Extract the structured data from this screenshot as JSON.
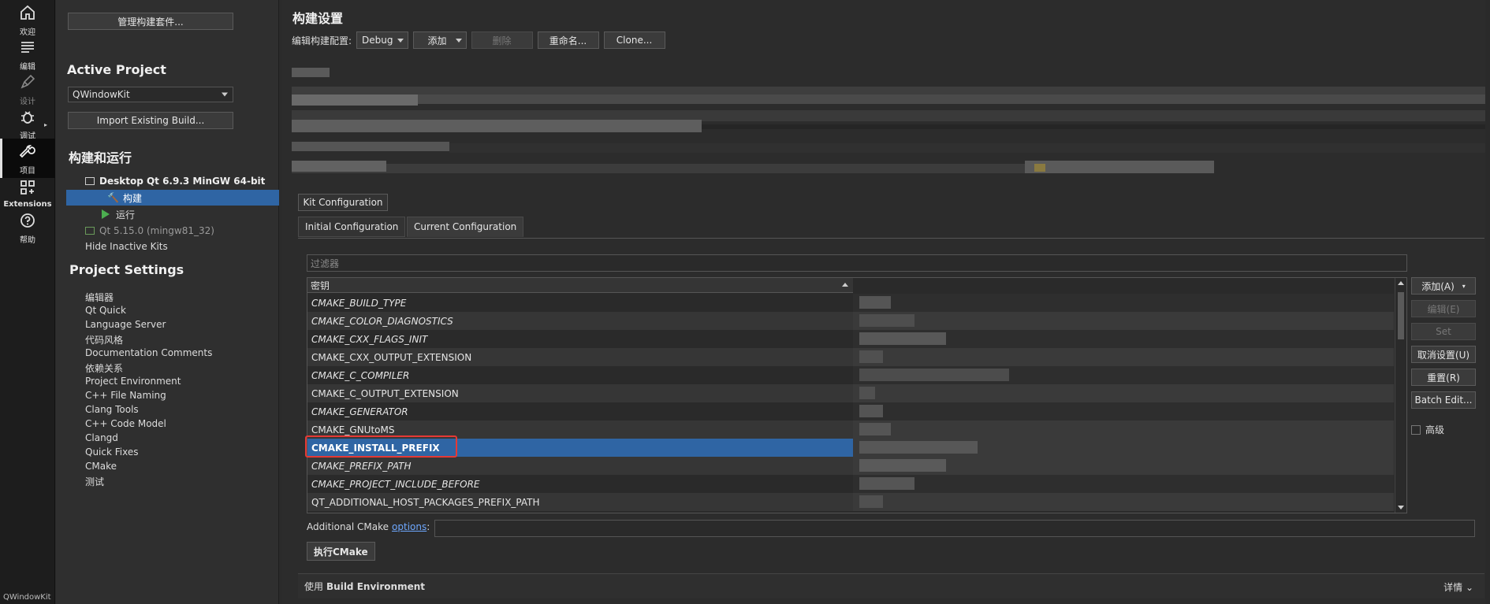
{
  "modes": [
    {
      "label": "欢迎",
      "icon": "home-icon"
    },
    {
      "label": "编辑",
      "icon": "edit-icon"
    },
    {
      "label": "设计",
      "icon": "design-icon"
    },
    {
      "label": "调试",
      "icon": "debug-icon"
    },
    {
      "label": "项目",
      "icon": "wrench-icon"
    },
    {
      "label": "Extensions",
      "icon": "extensions-icon"
    },
    {
      "label": "帮助",
      "icon": "help-icon"
    }
  ],
  "modebar_bottom": "QWindowKit",
  "left": {
    "manage_kits": "管理构建套件...",
    "active_project_heading": "Active Project",
    "project_select": "QWindowKit",
    "import_build": "Import Existing Build...",
    "build_run_heading": "构建和运行",
    "kit": "Desktop Qt 6.9.3 MinGW 64-bit",
    "build": "构建",
    "run": "运行",
    "inactive_kit": "Qt 5.15.0 (mingw81_32)",
    "hide_inactive": "Hide Inactive Kits",
    "project_settings_heading": "Project Settings",
    "settings": [
      "编辑器",
      "Qt Quick",
      "Language Server",
      "代码风格",
      "Documentation Comments",
      "依赖关系",
      "Project Environment",
      "C++ File Naming",
      "Clang Tools",
      "C++ Code Model",
      "Clangd",
      "Quick Fixes",
      "CMake",
      "测试"
    ]
  },
  "main": {
    "title": "构建设置",
    "edit_config_label": "编辑构建配置:",
    "config": "Debug",
    "add": "添加",
    "delete": "删除",
    "rename": "重命名...",
    "clone": "Clone...",
    "kit_config": "Kit Configuration",
    "tab_initial": "Initial Configuration",
    "tab_current": "Current Configuration",
    "filter_placeholder": "过滤器",
    "key_header": "密钥",
    "rows": [
      {
        "key": "CMAKE_BUILD_TYPE",
        "italic": true
      },
      {
        "key": "CMAKE_COLOR_DIAGNOSTICS",
        "italic": true
      },
      {
        "key": "CMAKE_CXX_FLAGS_INIT",
        "italic": true
      },
      {
        "key": "CMAKE_CXX_OUTPUT_EXTENSION",
        "italic": false
      },
      {
        "key": "CMAKE_C_COMPILER",
        "italic": true
      },
      {
        "key": "CMAKE_C_OUTPUT_EXTENSION",
        "italic": false
      },
      {
        "key": "CMAKE_GENERATOR",
        "italic": true
      },
      {
        "key": "CMAKE_GNUtoMS",
        "italic": false
      },
      {
        "key": "CMAKE_INSTALL_PREFIX",
        "italic": false
      },
      {
        "key": "CMAKE_PREFIX_PATH",
        "italic": true
      },
      {
        "key": "CMAKE_PROJECT_INCLUDE_BEFORE",
        "italic": true
      },
      {
        "key": "QT_ADDITIONAL_HOST_PACKAGES_PREFIX_PATH",
        "italic": false
      }
    ],
    "selected_row": "CMAKE_INSTALL_PREFIX",
    "side_buttons": {
      "add": "添加(A)",
      "edit": "编辑(E)",
      "set": "Set",
      "unset": "取消设置(U)",
      "reset": "重置(R)",
      "batch_edit": "Batch Edit..."
    },
    "advanced": "高级",
    "additional_label": "Additional CMake",
    "options_link": "options",
    "colon": ":",
    "run_cmake": "执行CMake",
    "env_prefix": "使用",
    "env_name": "Build Environment",
    "details": "详情"
  },
  "colors": {
    "selection": "#2f65a4",
    "highlight_box": "#e53935",
    "link": "#6ea8ff"
  }
}
